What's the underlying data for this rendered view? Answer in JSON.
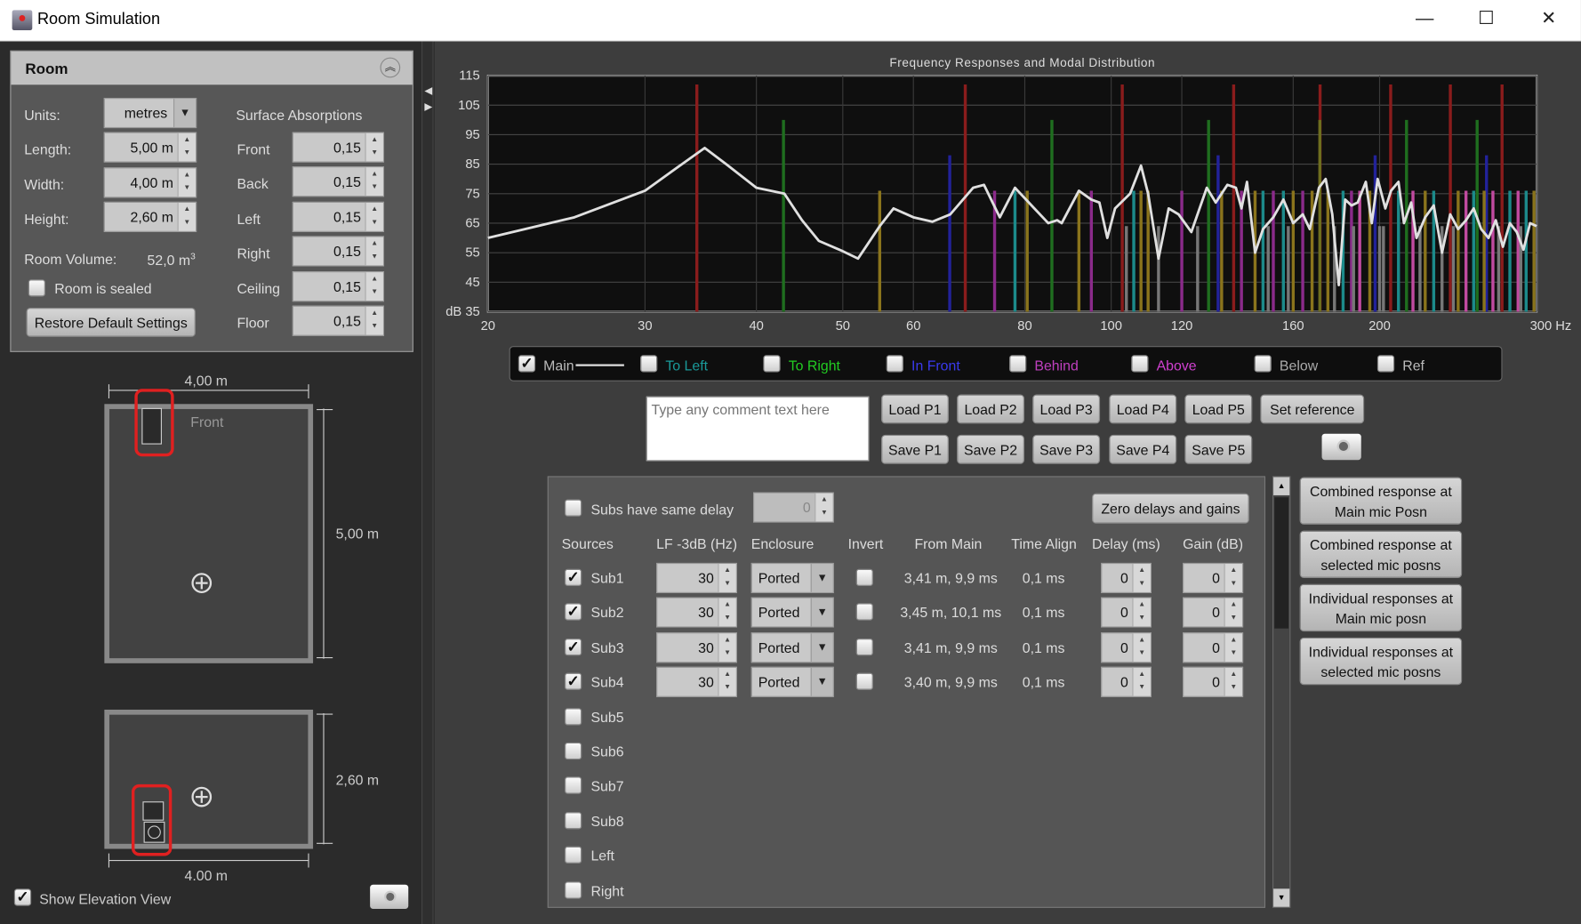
{
  "window": {
    "title": "Room Simulation",
    "minimize": "—",
    "maximize": "☐",
    "close": "✕"
  },
  "room": {
    "header": "Room",
    "units_label": "Units:",
    "units_value": "metres",
    "length_label": "Length:",
    "length_value": "5,00 m",
    "width_label": "Width:",
    "width_value": "4,00 m",
    "height_label": "Height:",
    "height_value": "2,60 m",
    "volume_label": "Room Volume:",
    "volume_value": "52,0 m",
    "volume_unit_sup": "3",
    "sealed_label": "Room is sealed",
    "sealed_checked": false,
    "restore_button": "Restore Default Settings",
    "absorptions_title": "Surface Absorptions",
    "absorptions": [
      {
        "label": "Front",
        "value": "0,15"
      },
      {
        "label": "Back",
        "value": "0,15"
      },
      {
        "label": "Left",
        "value": "0,15"
      },
      {
        "label": "Right",
        "value": "0,15"
      },
      {
        "label": "Ceiling",
        "value": "0,15"
      },
      {
        "label": "Floor",
        "value": "0,15"
      }
    ]
  },
  "plan": {
    "top_width": "4,00 m",
    "length": "5,00 m",
    "front_label": "Front",
    "elev_height": "2,60 m",
    "elev_width": "4.00 m",
    "show_elevation_label": "Show Elevation View",
    "show_elevation_checked": true
  },
  "chart_data": {
    "type": "line",
    "title": "Frequency Responses and Modal Distribution",
    "x_scale": "log",
    "xlim": [
      20,
      300
    ],
    "ylim": [
      35,
      115
    ],
    "x_ticks": [
      20,
      30,
      40,
      50,
      60,
      80,
      100,
      120,
      160,
      200,
      300
    ],
    "x_tick_labels": [
      "20",
      "30",
      "40",
      "50",
      "60",
      "80",
      "100",
      "120",
      "160",
      "200",
      "300 Hz"
    ],
    "y_ticks": [
      35,
      45,
      55,
      65,
      75,
      85,
      95,
      105,
      115
    ],
    "y_tick_labels": [
      "dB 35",
      "45",
      "55",
      "65",
      "75",
      "85",
      "95",
      "105",
      "115"
    ],
    "grid": true,
    "series": [
      {
        "name": "Main",
        "color": "#e0e0e0",
        "x": [
          20,
          25,
          30,
          33,
          35,
          37,
          40,
          43,
          45,
          47,
          50,
          52,
          55,
          57,
          60,
          63,
          66,
          70,
          72,
          75,
          78,
          82,
          85,
          87,
          88,
          92,
          95,
          97,
          99,
          101,
          105,
          108,
          110,
          113,
          116,
          119,
          123,
          128,
          131,
          135,
          138,
          140,
          142,
          145,
          148,
          152,
          156,
          160,
          164,
          167,
          171,
          174,
          177,
          180,
          183,
          186,
          189,
          193,
          196,
          199,
          203,
          206,
          210,
          213,
          217,
          220,
          225,
          230,
          235,
          240,
          245,
          250,
          255,
          260,
          265,
          270,
          275,
          280,
          285,
          290,
          295,
          300
        ],
        "y": [
          60,
          67,
          76,
          85,
          90.5,
          85,
          77,
          75,
          66,
          59,
          55.5,
          53,
          64,
          70,
          67,
          65.5,
          68,
          77,
          78,
          67,
          77,
          70,
          65,
          66,
          65,
          76,
          73,
          72,
          60,
          70,
          75,
          84.5,
          75,
          53,
          70,
          68,
          62,
          77,
          72,
          78,
          77,
          70,
          79,
          55,
          63,
          67,
          73,
          65,
          68,
          63,
          77,
          80,
          68,
          44,
          73,
          71,
          72,
          79,
          65,
          80,
          70,
          76,
          79,
          65,
          72,
          60,
          67,
          71,
          55,
          68,
          63,
          66,
          70,
          63,
          60,
          66,
          57,
          65,
          62,
          56,
          65,
          64
        ]
      }
    ],
    "modal_lines": [
      [
        34.3,
        112,
        "#8a1c1c"
      ],
      [
        68.6,
        112,
        "#8a1c1c"
      ],
      [
        102.9,
        112,
        "#8a1c1c"
      ],
      [
        137.2,
        112,
        "#8a1c1c"
      ],
      [
        171.5,
        112,
        "#8a1c1c"
      ],
      [
        205.8,
        112,
        "#8a1c1c"
      ],
      [
        240.1,
        112,
        "#8a1c1c"
      ],
      [
        274.4,
        112,
        "#8a1c1c"
      ],
      [
        42.9,
        100,
        "#1f6e1f"
      ],
      [
        85.8,
        100,
        "#1f6e1f"
      ],
      [
        128.6,
        100,
        "#1f6e1f"
      ],
      [
        171.4,
        100,
        "#6e6e1f"
      ],
      [
        214.4,
        100,
        "#1f6e1f"
      ],
      [
        257.3,
        100,
        "#1f6e1f"
      ],
      [
        65.9,
        88,
        "#22229a"
      ],
      [
        131.8,
        88,
        "#22229a"
      ],
      [
        197.7,
        88,
        "#22229a"
      ],
      [
        263.6,
        88,
        "#22229a"
      ],
      [
        55,
        76,
        "#8a741c"
      ],
      [
        78,
        76,
        "#1c8a8a"
      ],
      [
        80.5,
        76,
        "#8a741c"
      ],
      [
        74,
        76,
        "#8a2a8a"
      ],
      [
        92,
        76,
        "#8a741c"
      ],
      [
        95,
        76,
        "#8a2a8a"
      ],
      [
        106,
        76,
        "#1c8a8a"
      ],
      [
        108,
        76,
        "#8a741c"
      ],
      [
        110,
        76,
        "#8a741c"
      ],
      [
        120,
        76,
        "#8a2a8a"
      ],
      [
        133,
        76,
        "#8a741c"
      ],
      [
        140,
        76,
        "#8a2a8a"
      ],
      [
        145,
        76,
        "#8a741c"
      ],
      [
        148,
        76,
        "#1c8a8a"
      ],
      [
        152,
        76,
        "#8a2a8a"
      ],
      [
        156,
        76,
        "#1c8a8a"
      ],
      [
        160,
        76,
        "#8a741c"
      ],
      [
        164,
        76,
        "#8a2a8a"
      ],
      [
        168,
        76,
        "#8a741c"
      ],
      [
        175,
        76,
        "#8a741c"
      ],
      [
        182,
        76,
        "#1c8a8a"
      ],
      [
        186,
        76,
        "#8a2a8a"
      ],
      [
        190,
        76,
        "#c04aa0"
      ],
      [
        195,
        76,
        "#8a741c"
      ],
      [
        210,
        76,
        "#1c8a8a"
      ],
      [
        218,
        76,
        "#c04aa0"
      ],
      [
        225,
        76,
        "#8a741c"
      ],
      [
        230,
        76,
        "#1c8a8a"
      ],
      [
        245,
        76,
        "#8a741c"
      ],
      [
        250,
        76,
        "#c04aa0"
      ],
      [
        255,
        76,
        "#1c8a8a"
      ],
      [
        262,
        76,
        "#8a741c"
      ],
      [
        268,
        76,
        "#c04aa0"
      ],
      [
        280,
        76,
        "#1c8a8a"
      ],
      [
        286,
        76,
        "#c04aa0"
      ],
      [
        292,
        76,
        "#1c8a8a"
      ],
      [
        298,
        76,
        "#8a741c"
      ],
      [
        104,
        64,
        "#777777"
      ],
      [
        113,
        64,
        "#777777"
      ],
      [
        125,
        64,
        "#777777"
      ],
      [
        150,
        64,
        "#777777"
      ],
      [
        158,
        64,
        "#777777"
      ],
      [
        178,
        64,
        "#777777"
      ],
      [
        187,
        64,
        "#777777"
      ],
      [
        200,
        64,
        "#777777"
      ],
      [
        202,
        64,
        "#777777"
      ],
      [
        222,
        64,
        "#777777"
      ],
      [
        235,
        64,
        "#777777"
      ],
      [
        242,
        64,
        "#777777"
      ],
      [
        272,
        64,
        "#777777"
      ],
      [
        288,
        64,
        "#777777"
      ]
    ]
  },
  "legend": [
    {
      "label": "Main",
      "checked": true,
      "color": "#bbbbbb"
    },
    {
      "label": "To Left",
      "checked": false,
      "color": "#1a9a9a"
    },
    {
      "label": "To Right",
      "checked": false,
      "color": "#22cc22"
    },
    {
      "label": "In Front",
      "checked": false,
      "color": "#3a3aee"
    },
    {
      "label": "Behind",
      "checked": false,
      "color": "#c040c0"
    },
    {
      "label": "Above",
      "checked": false,
      "color": "#d040d0"
    },
    {
      "label": "Below",
      "checked": false,
      "color": "#aaaaaa"
    },
    {
      "label": "Ref",
      "checked": false,
      "color": "#bbbbbb"
    }
  ],
  "comment": {
    "placeholder": "Type any comment text here"
  },
  "presets": {
    "load": [
      "Load P1",
      "Load P2",
      "Load P3",
      "Load P4",
      "Load P5"
    ],
    "save": [
      "Save P1",
      "Save P2",
      "Save P3",
      "Save P4",
      "Save P5"
    ],
    "set_reference": "Set reference"
  },
  "sources": {
    "same_delay_label": "Subs have same delay",
    "same_delay_value": "0",
    "zero_button": "Zero delays and gains",
    "headers": [
      "Sources",
      "LF -3dB (Hz)",
      "Enclosure",
      "Invert",
      "From Main",
      "Time Align",
      "Delay (ms)",
      "Gain (dB)"
    ],
    "rows": [
      {
        "name": "Sub1",
        "checked": true,
        "lf": "30",
        "enclosure": "Ported",
        "from_main": "3,41 m, 9,9 ms",
        "time_align": "0,1 ms",
        "delay": "0",
        "gain": "0"
      },
      {
        "name": "Sub2",
        "checked": true,
        "lf": "30",
        "enclosure": "Ported",
        "from_main": "3,45 m, 10,1 ms",
        "time_align": "0,1 ms",
        "delay": "0",
        "gain": "0"
      },
      {
        "name": "Sub3",
        "checked": true,
        "lf": "30",
        "enclosure": "Ported",
        "from_main": "3,41 m, 9,9 ms",
        "time_align": "0,1 ms",
        "delay": "0",
        "gain": "0"
      },
      {
        "name": "Sub4",
        "checked": true,
        "lf": "30",
        "enclosure": "Ported",
        "from_main": "3,40 m, 9,9 ms",
        "time_align": "0,1 ms",
        "delay": "0",
        "gain": "0"
      },
      {
        "name": "Sub5",
        "checked": false
      },
      {
        "name": "Sub6",
        "checked": false
      },
      {
        "name": "Sub7",
        "checked": false
      },
      {
        "name": "Sub8",
        "checked": false
      },
      {
        "name": "Left",
        "checked": false
      },
      {
        "name": "Right",
        "checked": false
      }
    ]
  },
  "response_buttons": [
    "Combined response at Main mic Posn",
    "Combined response at selected mic posns",
    "Individual responses at Main mic posn",
    "Individual responses at selected mic posns"
  ]
}
